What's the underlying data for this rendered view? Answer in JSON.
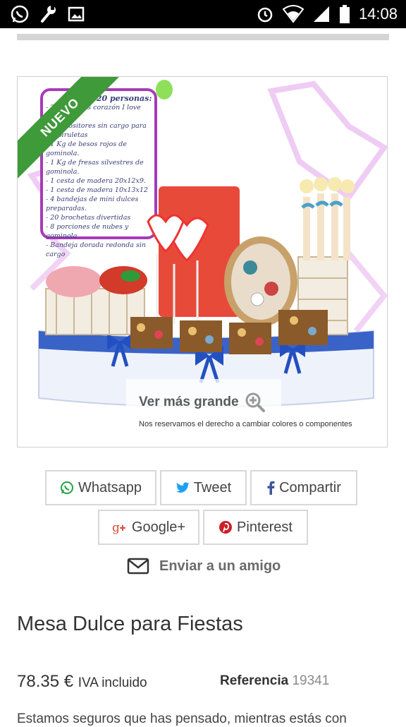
{
  "status_bar": {
    "time": "14:08",
    "icons": [
      "whatsapp-icon",
      "wrench-icon",
      "image-icon",
      "alarm-icon",
      "wifi-icon",
      "signal-icon",
      "battery-icon"
    ]
  },
  "product_image": {
    "badge": "NUEVO",
    "zoom_label": "Ver más grande",
    "disclaimer": "Nos reservamos el derecho a cambiar colores o componentes",
    "card_title": "Para 20 personas:",
    "card_items": [
      "- 20 piruletas corazón I love you",
      "- 2 expositores sin cargo para las piruletas",
      "- 1 Kg de besos rojos de gominola.",
      "- 1 Kg de fresas silvestres de gominola.",
      "- 1 cesta de madera 20x12x9.",
      "- 1 cesta de madera 10x13x12",
      "- 4 bandejas de mini dulces preparadas.",
      "- 20 brochetas divertidas",
      "- 8 porciones de nubes y gominola",
      "- Bandeja dorada redonda sin cargo"
    ]
  },
  "share": {
    "whatsapp": "Whatsapp",
    "tweet": "Tweet",
    "facebook": "Compartir",
    "google": "Google+",
    "pinterest": "Pinterest"
  },
  "send_friend": "Enviar a un amigo",
  "product": {
    "title": "Mesa Dulce para Fiestas",
    "price": "78.35 €",
    "tax_label": "IVA incluido",
    "reference_label": "Referencia",
    "reference_value": "19341",
    "description": "Estamos seguros que has pensado, mientras estás con"
  },
  "colors": {
    "ribbon": "#3f9a3a",
    "whatsapp": "#25a244",
    "twitter": "#1da1f2",
    "facebook": "#3b5998",
    "google": "#dd4b39",
    "pinterest": "#cb2027"
  }
}
